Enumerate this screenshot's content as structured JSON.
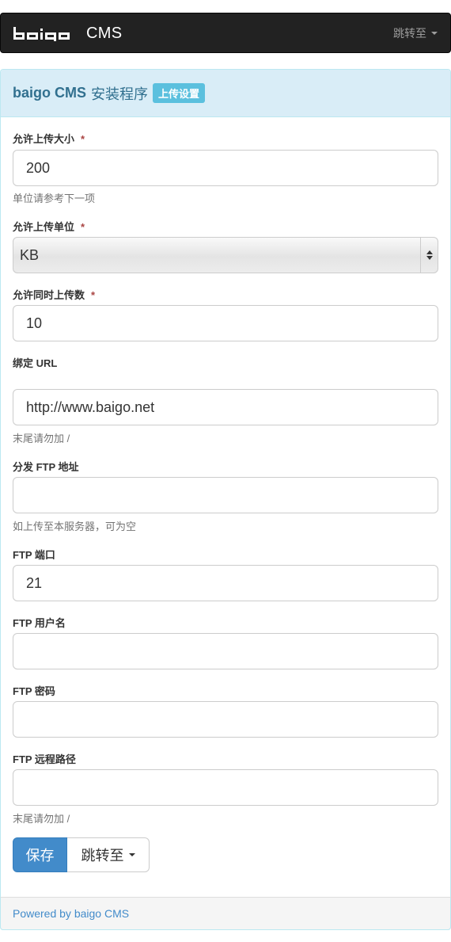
{
  "navbar": {
    "brand_text": "CMS",
    "jump_label": "跳转至"
  },
  "panel": {
    "title": "baigo CMS",
    "title_cn": "安装程序",
    "badge": "上传设置"
  },
  "fields": [
    {
      "label": "允许上传大小",
      "required": "*",
      "value": "200",
      "help": "单位请参考下一项"
    },
    {
      "label": "允许上传单位",
      "required": "*",
      "value": "KB"
    },
    {
      "label": "允许同时上传数",
      "required": "*",
      "value": "10"
    },
    {
      "label": "绑定 URL",
      "value": "http://www.baigo.net",
      "help": "末尾请勿加 /"
    },
    {
      "label": "分发 FTP 地址",
      "value": "",
      "help": "如上传至本服务器，可为空"
    },
    {
      "label": "FTP 端口",
      "value": "21"
    },
    {
      "label": "FTP 用户名",
      "value": ""
    },
    {
      "label": "FTP 密码",
      "value": ""
    },
    {
      "label": "FTP 远程路径",
      "value": "",
      "help": "末尾请勿加 /"
    }
  ],
  "buttons": {
    "save": "保存",
    "jump": "跳转至"
  },
  "footer": {
    "link": "Powered by baigo CMS"
  },
  "colors": {
    "navbar_bg": "#222222",
    "heading_bg": "#d9edf7",
    "primary": "#428bca",
    "badge": "#5bc0de"
  }
}
